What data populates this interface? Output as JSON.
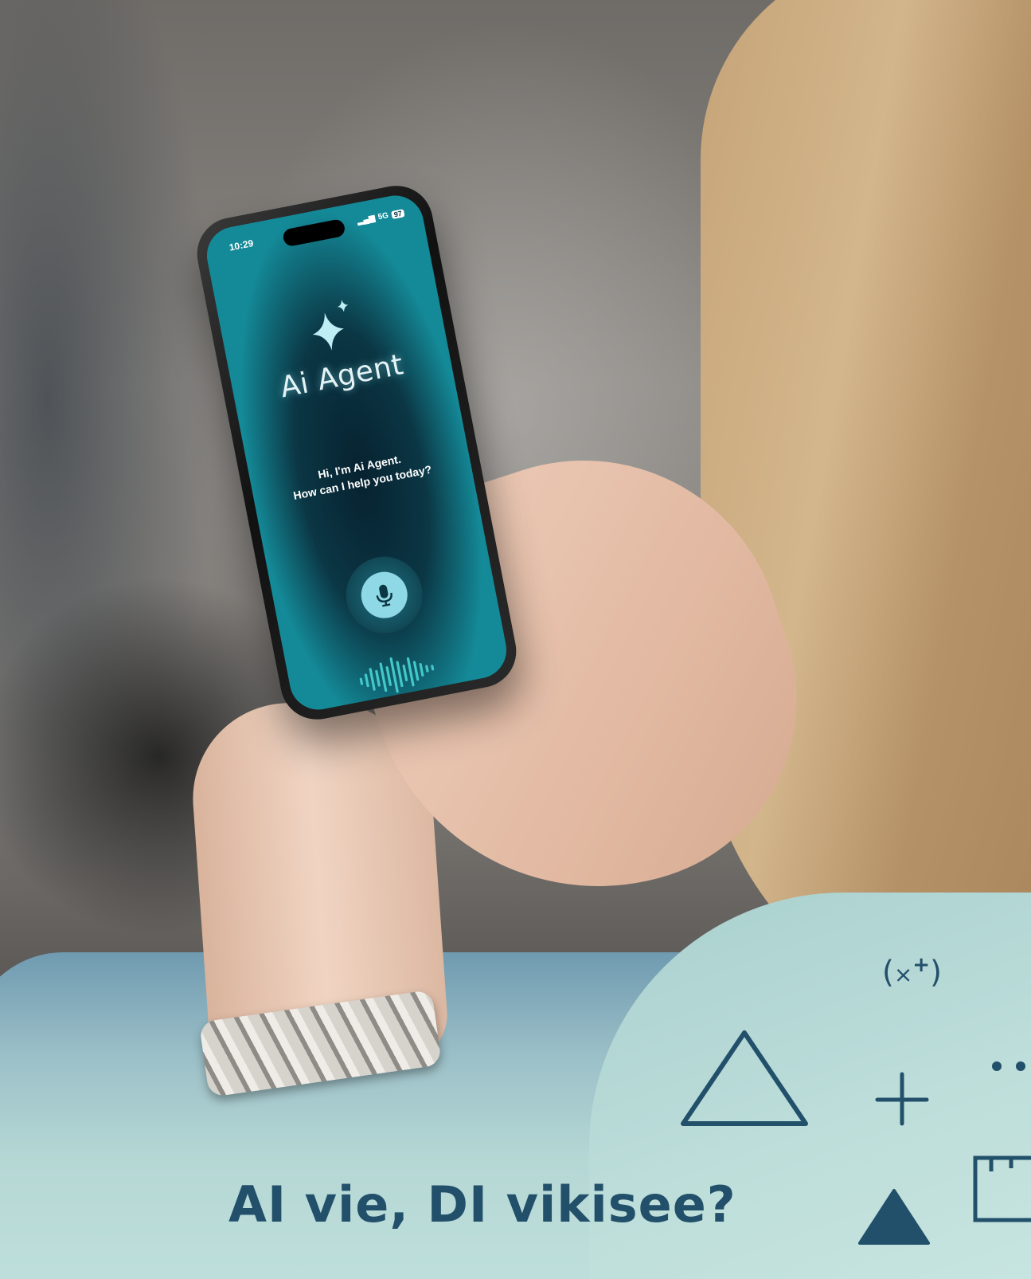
{
  "phone": {
    "status_time": "10:29",
    "status_network": "5G",
    "status_battery": "97",
    "app_title": "Ai Agent",
    "greeting_line1": "Hi, I'm Ai Agent.",
    "greeting_line2": "How can I help you today?",
    "icons": [
      "sparkle-icon",
      "microphone-icon",
      "sound-wave-icon"
    ]
  },
  "headline": "AI vie, DI vikisee?",
  "decor": {
    "formula_open": "(",
    "formula_x": "×",
    "formula_sup": "+",
    "formula_close": ")",
    "shapes": [
      "outline-triangle",
      "plus",
      "dots",
      "filled-triangle",
      "ruler-box"
    ],
    "accent_color": "#22506b",
    "screen_color": "#0b3644"
  }
}
